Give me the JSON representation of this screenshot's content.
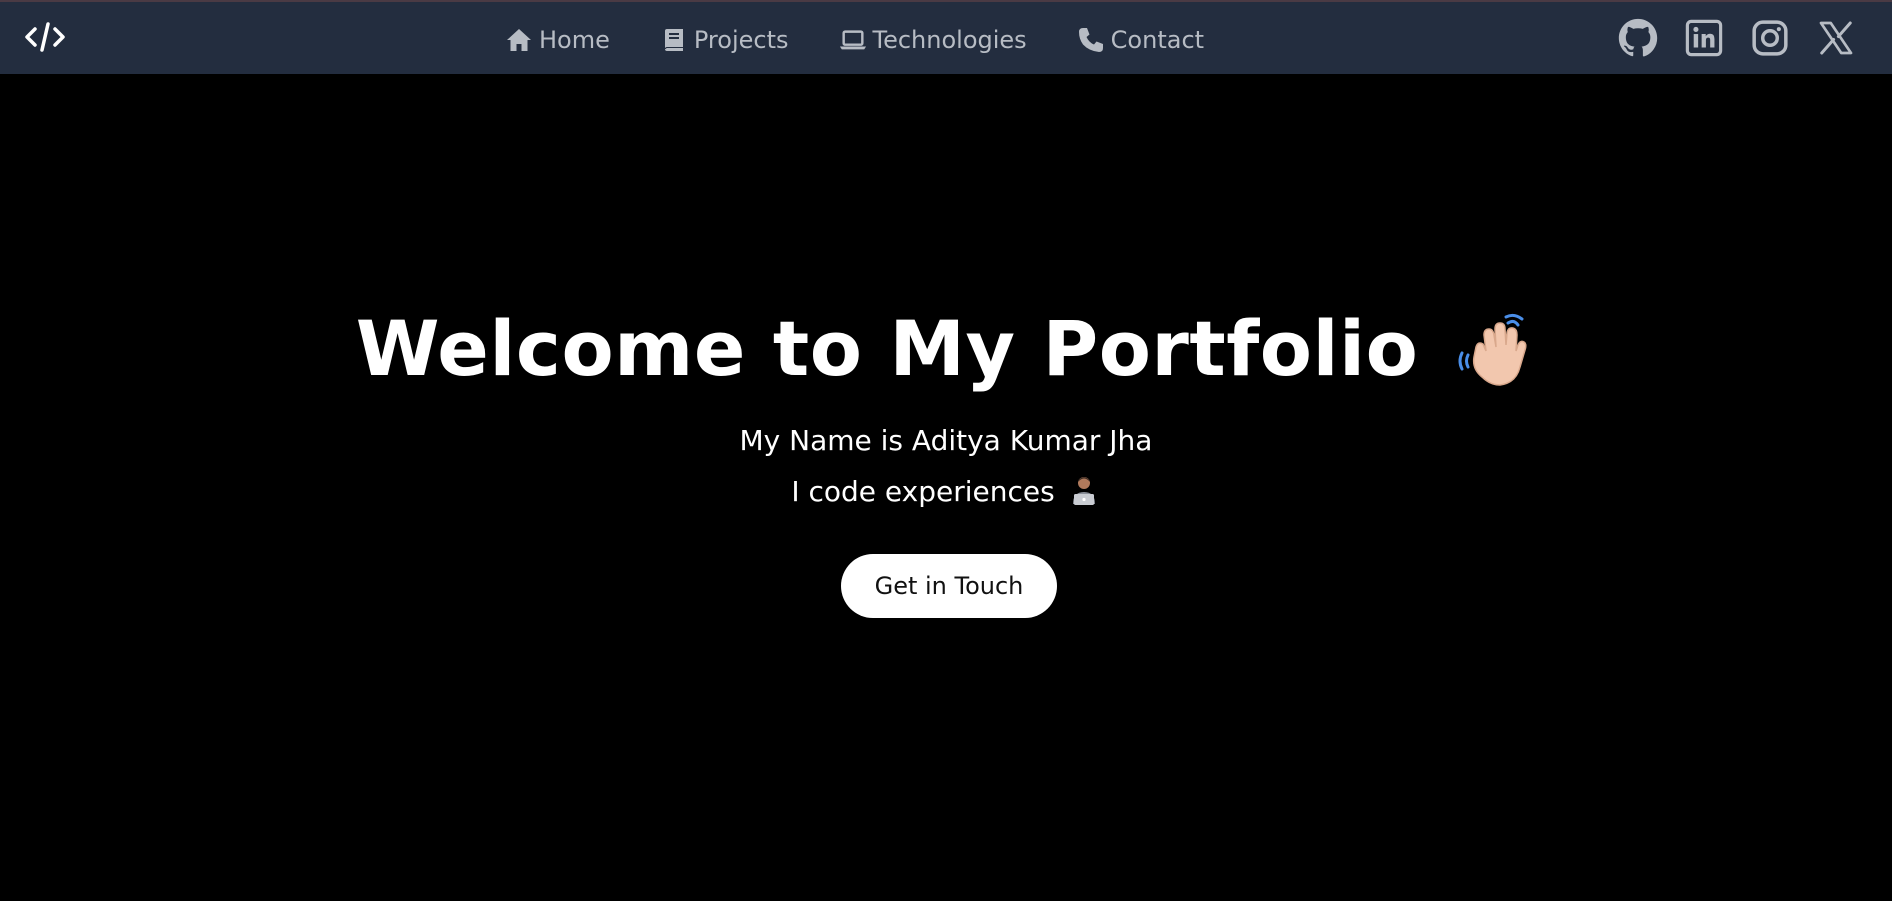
{
  "navbar": {
    "logo_icon": "code-brackets-icon",
    "links": [
      {
        "label": "Home",
        "icon": "home-icon"
      },
      {
        "label": "Projects",
        "icon": "book-icon"
      },
      {
        "label": "Technologies",
        "icon": "laptop-icon"
      },
      {
        "label": "Contact",
        "icon": "phone-icon"
      }
    ],
    "socials": [
      "github-icon",
      "linkedin-icon",
      "instagram-icon",
      "x-icon"
    ],
    "background": "#232d3f",
    "link_color": "#b7bcc4"
  },
  "hero": {
    "title": "Welcome to My Portfolio",
    "title_emoji": "waving-hand-icon",
    "name_line": "My Name is Aditya Kumar Jha",
    "tagline": "I code experiences",
    "tagline_emoji": "technologist-icon",
    "cta_label": "Get in Touch",
    "background": "#000000"
  }
}
